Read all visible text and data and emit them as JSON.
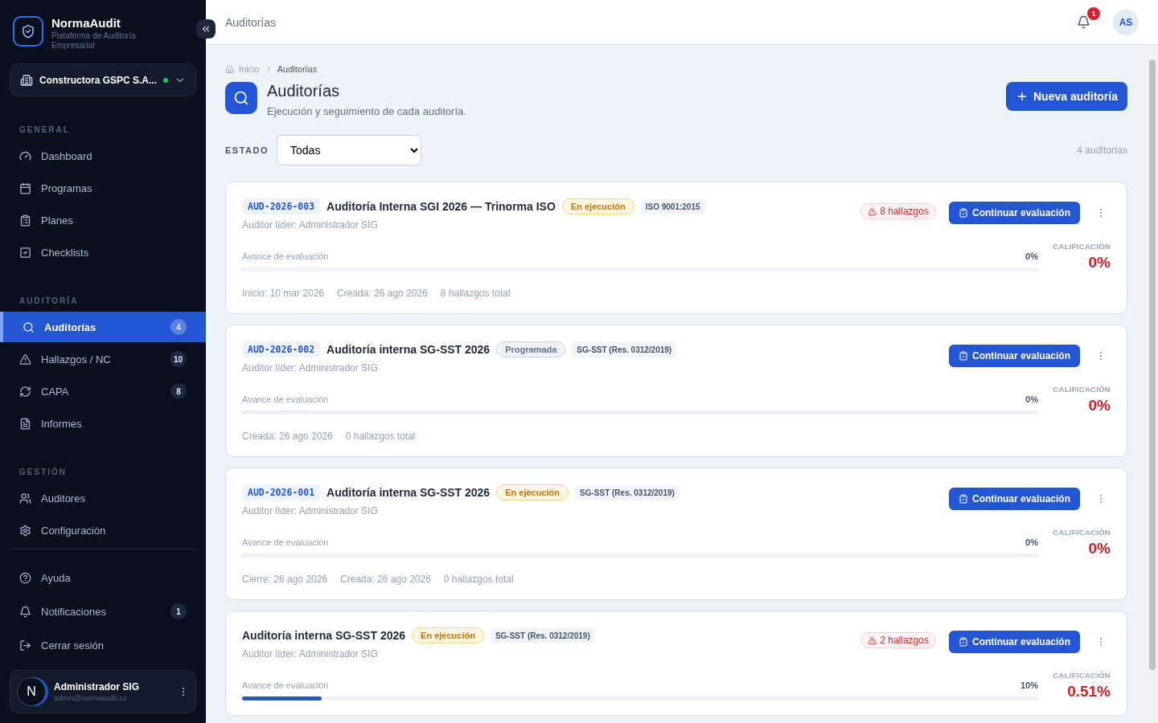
{
  "brand": {
    "name": "NormaAudit",
    "tagline": "Plataforma de Auditoría Empresarial"
  },
  "company": {
    "name": "Constructora GSPC S.A...",
    "online": true
  },
  "nav": [
    {
      "section": "GENERAL",
      "items": [
        {
          "label": "Dashboard",
          "selected": false
        },
        {
          "label": "Programas",
          "selected": false
        },
        {
          "label": "Planes",
          "selected": false
        },
        {
          "label": "Checklists",
          "selected": false
        }
      ]
    },
    {
      "section": "AUDITORÍA",
      "items": [
        {
          "label": "Auditorías",
          "badge": "4",
          "selected": true
        },
        {
          "label": "Hallazgos / NC",
          "badge": "10",
          "selected": false
        },
        {
          "label": "CAPA",
          "badge": "8",
          "selected": false
        },
        {
          "label": "Informes",
          "selected": false
        }
      ]
    },
    {
      "section": "GESTIÓN",
      "items": [
        {
          "label": "Auditores",
          "selected": false
        },
        {
          "label": "Configuración",
          "selected": false
        }
      ]
    }
  ],
  "footer_nav": [
    {
      "label": "Ayuda"
    },
    {
      "label": "Notificaciones",
      "badge": "1"
    },
    {
      "label": "Cerrar sesión"
    }
  ],
  "user": {
    "initial": "N",
    "name": "Administrador SIG",
    "email": "admin@normaaudit.co"
  },
  "topbar": {
    "title": "Auditorías",
    "notifications": "1",
    "avatar": "AS"
  },
  "breadcrumb": [
    "Inicio",
    "Auditorías"
  ],
  "header": {
    "title": "Auditorías",
    "subtitle": "Ejecución y seguimiento de cada auditoría.",
    "button": "Nueva auditoría"
  },
  "filter": {
    "label": "ESTADO",
    "value": "Todas",
    "count": "4 auditorías"
  },
  "audits": [
    {
      "code": "AUD-2026-003",
      "title": "Auditoría Interna SGI 2026 — Trinorma ISO",
      "status": {
        "label": "En ejecución",
        "kind": "running"
      },
      "standard": "ISO 9001:2015",
      "auditor": "Auditor líder: Administrador SIG",
      "findings": "8 hallazgos",
      "button": "Continuar evaluación",
      "progress_label": "Avance de evaluación",
      "progress_text": "0%",
      "level": 0,
      "score_label": "CALIFICACIÓN",
      "score": "0%",
      "meta": [
        "Inicio: 10 mar 2026",
        "Creada: 26 ago 2026",
        "8 hallazgos total"
      ]
    },
    {
      "code": "AUD-2026-002",
      "title": "Auditoría interna SG-SST 2026",
      "status": {
        "label": "Programada",
        "kind": "scheduled"
      },
      "standard": "SG-SST (Res. 0312/2019)",
      "auditor": "Auditor líder: Administrador SIG",
      "button": "Continuar evaluación",
      "progress_label": "Avance de evaluación",
      "progress_text": "0%",
      "level": 0,
      "score_label": "CALIFICACIÓN",
      "score": "0%",
      "meta": [
        "Creada: 26 ago 2026",
        "0 hallazgos total"
      ]
    },
    {
      "code": "AUD-2026-001",
      "title": "Auditoría interna SG-SST 2026",
      "status": {
        "label": "En ejecución",
        "kind": "running"
      },
      "standard": "SG-SST (Res. 0312/2019)",
      "auditor": "Auditor líder: Administrador SIG",
      "button": "Continuar evaluación",
      "progress_label": "Avance de evaluación",
      "progress_text": "0%",
      "level": 0,
      "score_label": "CALIFICACIÓN",
      "score": "0%",
      "meta": [
        "Cierre: 26 ago 2026",
        "Creada: 26 ago 2026",
        "0 hallazgos total"
      ]
    },
    {
      "title": "Auditoría interna SG-SST 2026",
      "status": {
        "label": "En ejecución",
        "kind": "running"
      },
      "standard": "SG-SST (Res. 0312/2019)",
      "auditor": "Auditor líder: Administrador SIG",
      "findings": "2 hallazgos",
      "button": "Continuar evaluación",
      "progress_label": "Avance de evaluación",
      "progress_text": "10%",
      "level": 0.1,
      "score_label": "CALIFICACIÓN",
      "score": "0.51%"
    }
  ]
}
